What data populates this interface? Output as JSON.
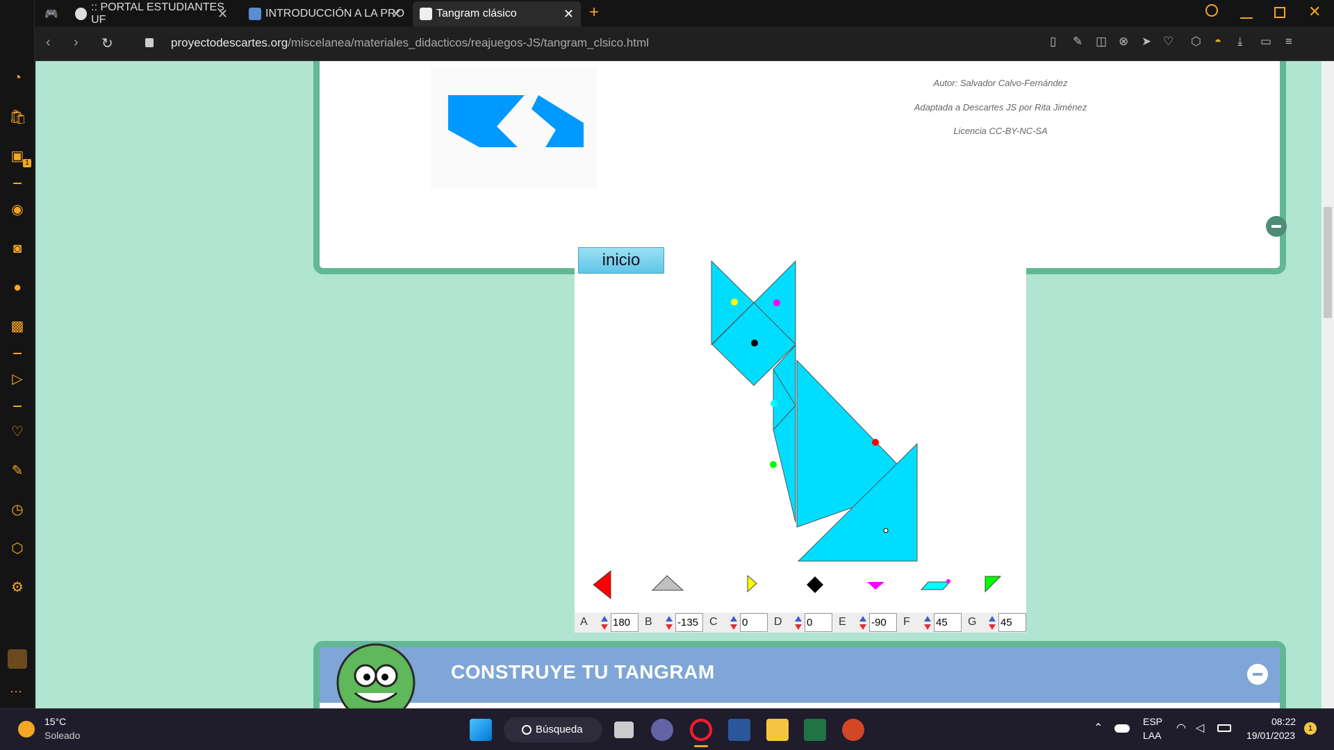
{
  "tabs": [
    {
      "label": ":: PORTAL ESTUDIANTES UF",
      "icon": "globe-icon"
    },
    {
      "label": "INTRODUCCIÓN A LA PRO",
      "icon": "document-icon"
    },
    {
      "label": "Tangram clásico",
      "icon": "page-icon",
      "active": true
    }
  ],
  "address": {
    "domain": "proyectodescartes.org",
    "path": "/miscelanea/materiales_didacticos/reajuegos-JS/tangram_clsico.html"
  },
  "credits": {
    "author": "Autor: Salvador Calvo-Fernández",
    "adapted": "Adaptada a Descartes JS por Rita Jiménez",
    "license": "Licencia CC-BY-NC-SA"
  },
  "tangram": {
    "start_button": "inicio",
    "controls": [
      {
        "label": "A",
        "value": "180"
      },
      {
        "label": "B",
        "value": "-135"
      },
      {
        "label": "C",
        "value": "0"
      },
      {
        "label": "D",
        "value": "0"
      },
      {
        "label": "E",
        "value": "-90"
      },
      {
        "label": "F",
        "value": "45"
      },
      {
        "label": "G",
        "value": "45"
      }
    ],
    "colors": {
      "piece": "#00ddff",
      "red": "#ff0000",
      "gray": "#c0c0c0",
      "yellow": "#ffff00",
      "black": "#000000",
      "magenta": "#ff00ff",
      "cyan": "#00ffff",
      "green": "#00ff00"
    }
  },
  "section": {
    "title": "CONSTRUYE TU TANGRAM"
  },
  "taskbar": {
    "weather_temp": "15°C",
    "weather_desc": "Soleado",
    "search": "Búsqueda",
    "lang1": "ESP",
    "lang2": "LAA",
    "time": "08:22",
    "date": "19/01/2023",
    "notif_count": "1"
  },
  "sidebar": {
    "badge": "1"
  }
}
